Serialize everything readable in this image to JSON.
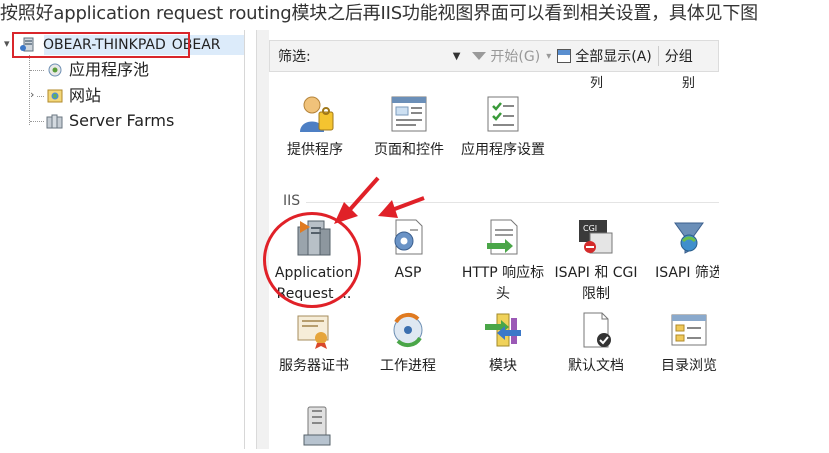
{
  "caption": "按照好application request routing模块之后再IIS功能视图界面可以看到相关设置，具体见下图",
  "tree": {
    "root": {
      "label": "OBEAR-THINKPAD",
      "trailing": "OBEAR"
    },
    "children": [
      {
        "label": "应用程序池",
        "icon": "app-pool-icon"
      },
      {
        "label": "网站",
        "icon": "sites-icon"
      },
      {
        "label": "Server Farms",
        "icon": "server-farms-icon"
      }
    ]
  },
  "toolbar": {
    "filter_label": "筛选:",
    "filter_value": "",
    "start_label": "开始(G)",
    "show_all_label": "全部显示(A)",
    "group_label": "分组"
  },
  "partial_labels": [
    "列",
    "别"
  ],
  "top_tiles": [
    {
      "label": "提供程序",
      "icon": "providers-icon"
    },
    {
      "label": "页面和控件",
      "icon": "pages-controls-icon"
    },
    {
      "label": "应用程序设置",
      "icon": "app-settings-icon"
    }
  ],
  "group": {
    "label": "IIS"
  },
  "iis_row1": [
    {
      "label": "Application Request ...",
      "icon": "arr-server-icon"
    },
    {
      "label": "ASP",
      "icon": "asp-icon"
    },
    {
      "label": "HTTP 响应标头",
      "icon": "http-headers-icon"
    },
    {
      "label": "ISAPI 和 CGI 限制",
      "icon": "isapi-cgi-icon"
    },
    {
      "label": "ISAPI 筛选",
      "icon": "isapi-filter-icon"
    }
  ],
  "iis_row2": [
    {
      "label": "服务器证书",
      "icon": "server-certificates-icon"
    },
    {
      "label": "工作进程",
      "icon": "worker-processes-icon"
    },
    {
      "label": "模块",
      "icon": "modules-icon"
    },
    {
      "label": "默认文档",
      "icon": "default-document-icon"
    },
    {
      "label": "目录浏览",
      "icon": "directory-browsing-icon"
    }
  ],
  "colors": {
    "highlight": "#d9262b",
    "annotation_red": "#e02128",
    "selection": "#dcebfa"
  }
}
